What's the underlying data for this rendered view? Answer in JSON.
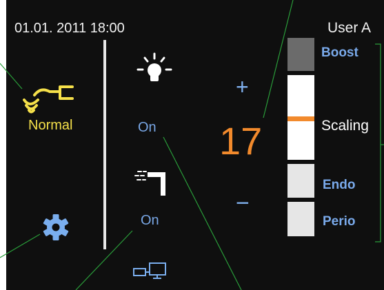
{
  "status_bar": {
    "datetime": "01.01. 2011 18:00",
    "user": "User A"
  },
  "left_panel": {
    "mode_icon": "wireless-connector-icon",
    "mode_label": "Normal",
    "settings_icon": "gear-icon"
  },
  "middle_panel": {
    "light_icon": "light-bulb-icon",
    "light_status": "On",
    "water_icon": "water-spray-icon",
    "water_status": "On",
    "connection_icon": "pc-connection-icon"
  },
  "power_panel": {
    "increase_label": "+",
    "value": "17",
    "decrease_label": "−"
  },
  "modes": {
    "boost": "Boost",
    "scaling": "Scaling",
    "endo": "Endo",
    "perio": "Perio",
    "selected": "Scaling"
  },
  "colors": {
    "background": "#0f0f0f",
    "accent_orange": "#f28a2c",
    "accent_blue": "#79a7e6",
    "mode_yellow": "#f5e04a",
    "callout_line": "#2a9d3a"
  }
}
